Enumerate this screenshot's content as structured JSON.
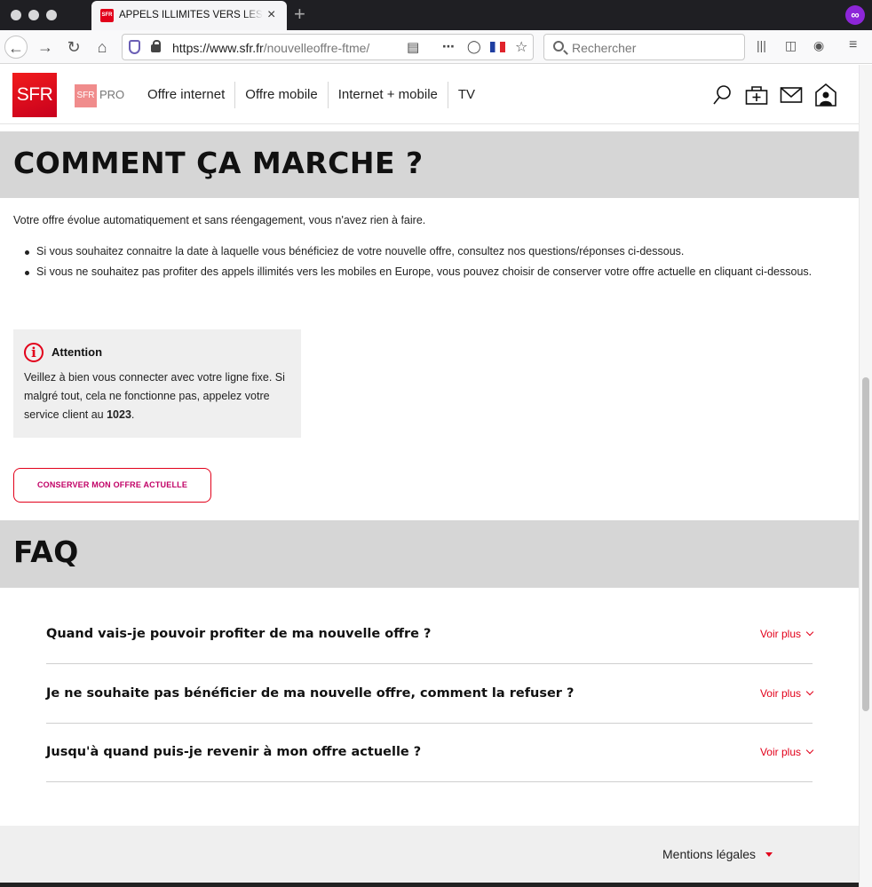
{
  "browser": {
    "tab_title": "APPELS ILLIMITÉS VERS LES MOBILES",
    "tab_favicon": "SFR",
    "close_icon": "×",
    "newtab_icon": "+",
    "url_host": "https://www.sfr.fr",
    "url_path": "/nouvelleoffre-ftme/",
    "search_placeholder": "Rechercher",
    "private_icon": "∞"
  },
  "site": {
    "logo": "SFR",
    "logo_pro_box": "SFR",
    "logo_pro": "PRO",
    "nav": [
      "Offre internet",
      "Offre mobile",
      "Internet + mobile",
      "TV"
    ]
  },
  "how": {
    "title": "COMMENT ÇA MARCHE ?",
    "intro": "Votre offre évolue automatiquement et sans réengagement, vous n'avez rien à faire.",
    "bullets": [
      "Si vous souhaitez connaitre la date à laquelle vous bénéficiez de votre nouvelle offre, consultez nos questions/réponses ci-dessous.",
      "Si vous ne souhaitez pas profiter des appels illimités vers les mobiles en Europe, vous pouvez choisir de conserver votre offre actuelle en cliquant ci-dessous."
    ]
  },
  "attention": {
    "icon": "i",
    "title": "Attention",
    "text_before": "Veillez à bien vous connecter avec votre ligne fixe. Si malgré tout, cela ne fonctionne pas, appelez votre service client au ",
    "number": "1023",
    "text_after": "."
  },
  "keep_button": "CONSERVER MON OFFRE ACTUELLE",
  "faq": {
    "title": "FAQ",
    "more_label": "Voir plus",
    "items": [
      "Quand vais-je pouvoir profiter de ma nouvelle offre ?",
      "Je ne souhaite pas bénéficier de ma nouvelle offre, comment la refuser ?",
      "Jusqu'à quand puis-je revenir à mon offre actuelle ?"
    ]
  },
  "footer": {
    "legal": "Mentions légales"
  },
  "colors": {
    "brand_red": "#e2001a",
    "band_gray": "#d6d6d6",
    "button_text": "#c10066"
  }
}
